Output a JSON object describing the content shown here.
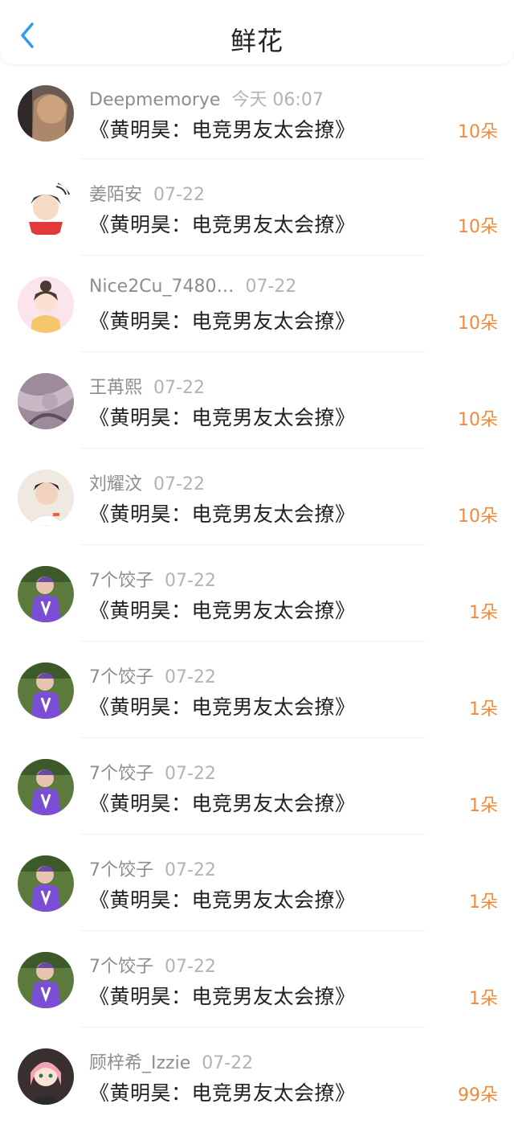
{
  "header": {
    "title": "鲜花",
    "back_icon": "chevron-left-icon"
  },
  "colors": {
    "accent_blue": "#2d9cf0",
    "flower_orange": "#f08a3c"
  },
  "rows": [
    {
      "user": "Deepmemorye",
      "time": "今天 06:07",
      "book": "《黄明昊：电竞男友太会撩》",
      "flowers": "10朵",
      "avatar": "photo"
    },
    {
      "user": "姜陌安",
      "time": "07-22",
      "book": "《黄明昊：电竞男友太会撩》",
      "flowers": "10朵",
      "avatar": "cartoon"
    },
    {
      "user": "Nice2Cu_7480…",
      "time": "07-22",
      "book": "《黄明昊：电竞男友太会撩》",
      "flowers": "10朵",
      "avatar": "girl"
    },
    {
      "user": "王苒熙",
      "time": "07-22",
      "book": "《黄明昊：电竞男友太会撩》",
      "flowers": "10朵",
      "avatar": "texture"
    },
    {
      "user": "刘耀汶",
      "time": "07-22",
      "book": "《黄明昊：电竞男友太会撩》",
      "flowers": "10朵",
      "avatar": "boy"
    },
    {
      "user": "7个饺子",
      "time": "07-22",
      "book": "《黄明昊：电竞男友太会撩》",
      "flowers": "1朵",
      "avatar": "purple"
    },
    {
      "user": "7个饺子",
      "time": "07-22",
      "book": "《黄明昊：电竞男友太会撩》",
      "flowers": "1朵",
      "avatar": "purple"
    },
    {
      "user": "7个饺子",
      "time": "07-22",
      "book": "《黄明昊：电竞男友太会撩》",
      "flowers": "1朵",
      "avatar": "purple"
    },
    {
      "user": "7个饺子",
      "time": "07-22",
      "book": "《黄明昊：电竞男友太会撩》",
      "flowers": "1朵",
      "avatar": "purple"
    },
    {
      "user": "7个饺子",
      "time": "07-22",
      "book": "《黄明昊：电竞男友太会撩》",
      "flowers": "1朵",
      "avatar": "purple"
    },
    {
      "user": "顾梓希_Izzie",
      "time": "07-22",
      "book": "《黄明昊：电竞男友太会撩》",
      "flowers": "99朵",
      "avatar": "anime"
    }
  ]
}
